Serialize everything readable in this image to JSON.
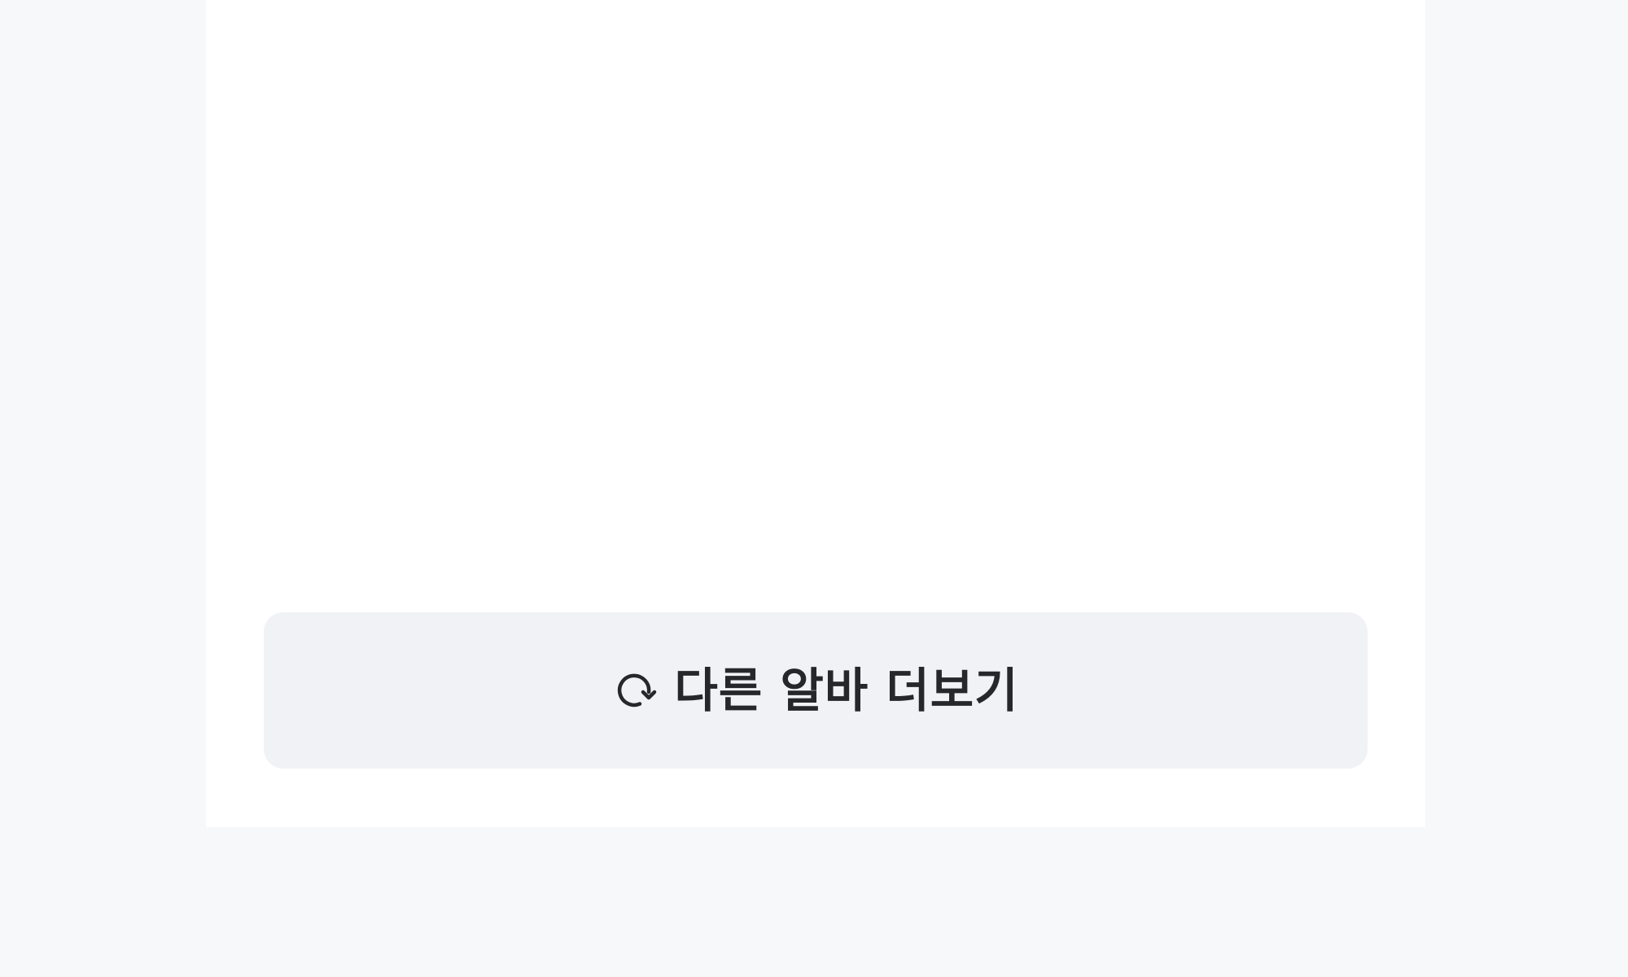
{
  "more_button": {
    "label": "다른 알바 더보기",
    "icon": "refresh-icon"
  },
  "colors": {
    "page_background": "#f7f8fa",
    "panel_background": "#ffffff",
    "button_background": "#f1f2f6",
    "text": "#26272b"
  }
}
